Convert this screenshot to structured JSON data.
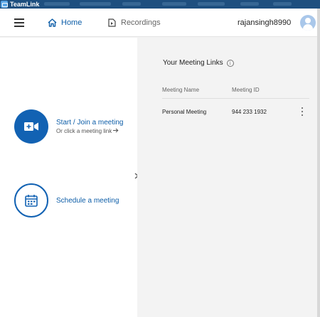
{
  "window": {
    "title": "TeamLink"
  },
  "header": {
    "home_label": "Home",
    "recordings_label": "Recordings",
    "username": "rajansingh8990",
    "colors": {
      "accent": "#0e5ea8",
      "muted": "#666666"
    }
  },
  "actions": {
    "start_join_title": "Start / Join a meeting",
    "start_join_sub": "Or click a meeting link",
    "schedule_title": "Schedule a meeting"
  },
  "meeting_links": {
    "title": "Your Meeting Links",
    "columns": [
      "Meeting Name",
      "Meeting ID"
    ],
    "rows": [
      {
        "name": "Personal Meeting",
        "id": "944 233 1932"
      }
    ]
  },
  "icons": [
    "teamlink-logo-icon",
    "hamburger-menu-icon",
    "home-icon",
    "recordings-icon",
    "user-avatar-icon",
    "video-camera-plus-icon",
    "calendar-icon",
    "chevron-right-icon",
    "info-icon",
    "more-vertical-icon",
    "arrow-right-icon"
  ]
}
